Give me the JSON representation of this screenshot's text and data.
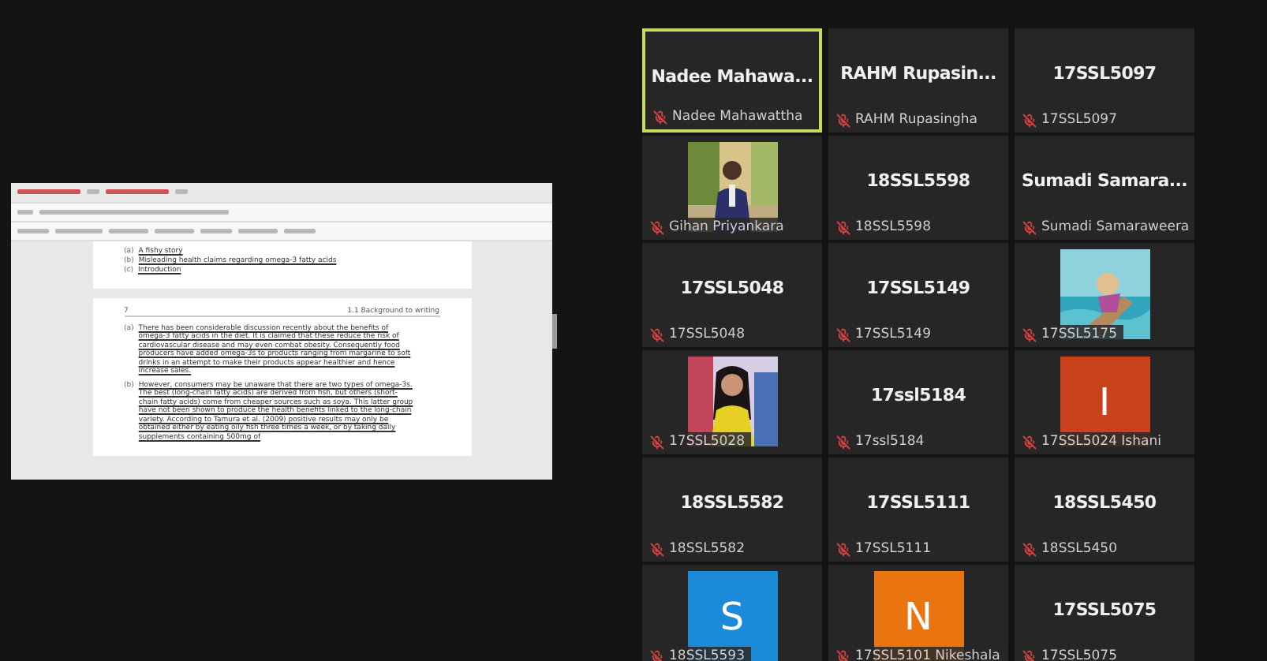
{
  "shared_screen": {
    "document": {
      "contents": [
        {
          "marker": "(a)",
          "text": "A fishy story"
        },
        {
          "marker": "(b)",
          "text": "Misleading health claims regarding omega-3 fatty acids"
        },
        {
          "marker": "(c)",
          "text": "Introduction"
        }
      ],
      "page_number": "7",
      "running_head": "1.1 Background to writing",
      "paragraphs": [
        {
          "marker": "(a)",
          "text": "There has been considerable discussion recently about the benefits of omega-3 fatty acids in the diet. It is claimed that these reduce the risk of cardiovascular disease and may even combat obesity. Consequently food producers have added omega-3s to products ranging from margarine to soft drinks in an attempt to make their products appear healthier and hence increase sales."
        },
        {
          "marker": "(b)",
          "text": "However, consumers may be unaware that there are two types of omega-3s. The best (long-chain fatty acids) are derived from fish, but others (short-chain fatty acids) come from cheaper sources such as soya. This latter group have not been shown to produce the health benefits linked to the long-chain variety. According to Tamura et al. (2009) positive results may only be obtained either by eating oily fish three times a week, or by taking daily supplements containing 500mg of"
        }
      ]
    }
  },
  "participants": [
    {
      "kind": "name",
      "display": "Nadee Mahawa...",
      "name": "Nadee Mahawattha",
      "muted": true,
      "speaking": true
    },
    {
      "kind": "name",
      "display": "RAHM Rupasin...",
      "name": "RAHM Rupasingha",
      "muted": true,
      "speaking": false
    },
    {
      "kind": "name",
      "display": "17SSL5097",
      "name": "17SSL5097",
      "muted": true,
      "speaking": false
    },
    {
      "name": "Gihan Priyankara",
      "muted": true,
      "speaking": false
    },
    {
      "kind": "name",
      "display": "18SSL5598",
      "name": "18SSL5598",
      "muted": true,
      "speaking": false
    },
    {
      "kind": "name",
      "display": "Sumadi Samara...",
      "name": "Sumadi Samaraweera",
      "muted": true,
      "speaking": false
    },
    {
      "kind": "name",
      "display": "17SSL5048",
      "name": "17SSL5048",
      "muted": true,
      "speaking": false
    },
    {
      "kind": "name",
      "display": "17SSL5149",
      "name": "17SSL5149",
      "muted": true,
      "speaking": false
    },
    {
      "name": "17SSL5175",
      "muted": true,
      "speaking": false
    },
    {
      "name": "17SSL5028",
      "muted": true,
      "speaking": false
    },
    {
      "kind": "name",
      "display": "17ssl5184",
      "name": "17ssl5184",
      "muted": true,
      "speaking": false
    },
    {
      "kind": "initial",
      "initial": "I",
      "color": "#c8431b",
      "name": "17SSL5024 Ishani",
      "muted": true,
      "speaking": false
    },
    {
      "kind": "name",
      "display": "18SSL5582",
      "name": "18SSL5582",
      "muted": true,
      "speaking": false
    },
    {
      "kind": "name",
      "display": "17SSL5111",
      "name": "17SSL5111",
      "muted": true,
      "speaking": false
    },
    {
      "kind": "name",
      "display": "18SSL5450",
      "name": "18SSL5450",
      "muted": true,
      "speaking": false
    },
    {
      "kind": "initial",
      "initial": "S",
      "color": "#1b8ad8",
      "name": "18SSL5593",
      "muted": true,
      "speaking": false
    },
    {
      "kind": "initial",
      "initial": "N",
      "color": "#ea7410",
      "name": "17SSL5101 Nikeshala",
      "muted": true,
      "speaking": false
    },
    {
      "kind": "name",
      "display": "17SSL5075",
      "name": "17SSL5075",
      "muted": true,
      "speaking": false
    }
  ]
}
